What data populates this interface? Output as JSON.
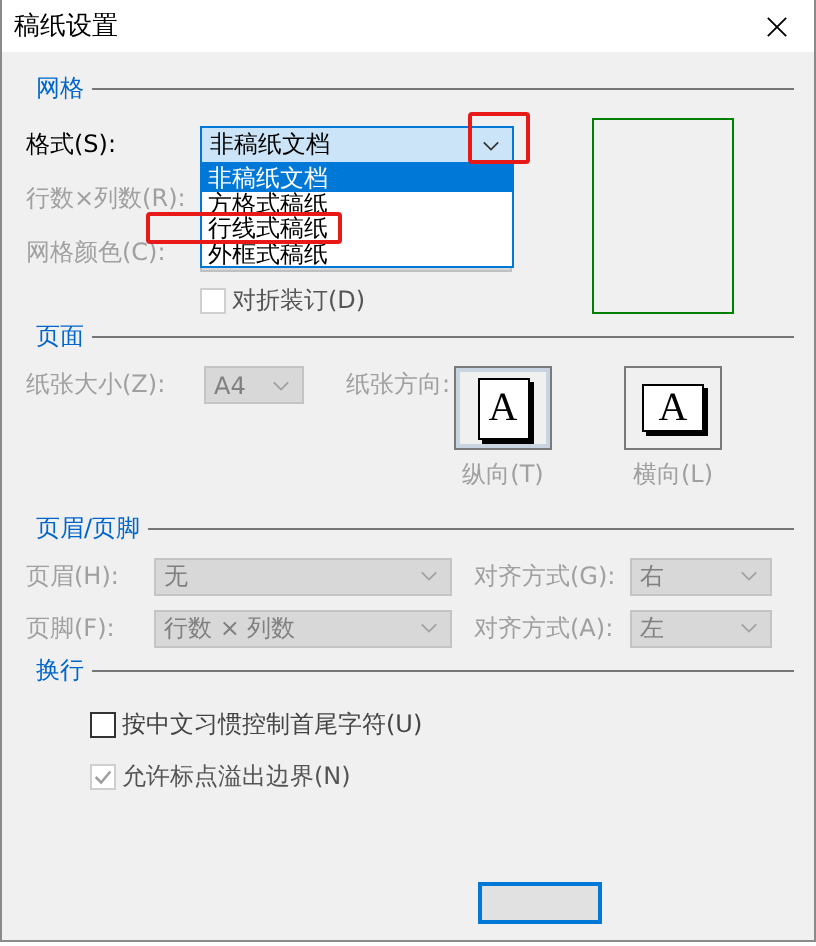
{
  "window": {
    "title": "稿纸设置"
  },
  "grid": {
    "title": "网格",
    "format": {
      "label": "格式(S):",
      "value": "非稿纸文档",
      "expanded": true,
      "arrow_highlighted": true,
      "options": [
        {
          "label": "非稿纸文档",
          "selected": true,
          "highlighted": false
        },
        {
          "label": "方格式稿纸",
          "selected": false,
          "highlighted": false
        },
        {
          "label": "行线式稿纸",
          "selected": false,
          "highlighted": true
        },
        {
          "label": "外框式稿纸",
          "selected": false,
          "highlighted": false
        }
      ]
    },
    "rows_cols": {
      "label": "行数×列数(R):",
      "disabled": true
    },
    "grid_color": {
      "label": "网格颜色(C):",
      "disabled": true
    },
    "fold_binding": {
      "label": "对折装订(D)",
      "checked": false,
      "disabled": true
    }
  },
  "page": {
    "title": "页面",
    "paper_size": {
      "label": "纸张大小(Z):",
      "value": "A4",
      "disabled": true
    },
    "orientation_label": "纸张方向:",
    "orientations": [
      {
        "glyph": "A",
        "label": "纵向(T)",
        "selected": true,
        "kind": "portrait"
      },
      {
        "glyph": "A",
        "label": "横向(L)",
        "selected": false,
        "kind": "landscape"
      }
    ]
  },
  "header_footer": {
    "title": "页眉/页脚",
    "disabled": true,
    "rows": [
      {
        "label": "页眉(H):",
        "value": "无",
        "align_label": "对齐方式(G):",
        "align_value": "右"
      },
      {
        "label": "页脚(F):",
        "value": "行数 × 列数",
        "align_label": "对齐方式(A):",
        "align_value": "左"
      }
    ]
  },
  "wrap": {
    "title": "换行",
    "options": [
      {
        "label": "按中文习惯控制首尾字符(U)",
        "checked": false,
        "disabled": false
      },
      {
        "label": "允许标点溢出边界(N)",
        "checked": true,
        "disabled": true
      }
    ]
  },
  "buttons": [
    {
      "focused": true
    }
  ]
}
